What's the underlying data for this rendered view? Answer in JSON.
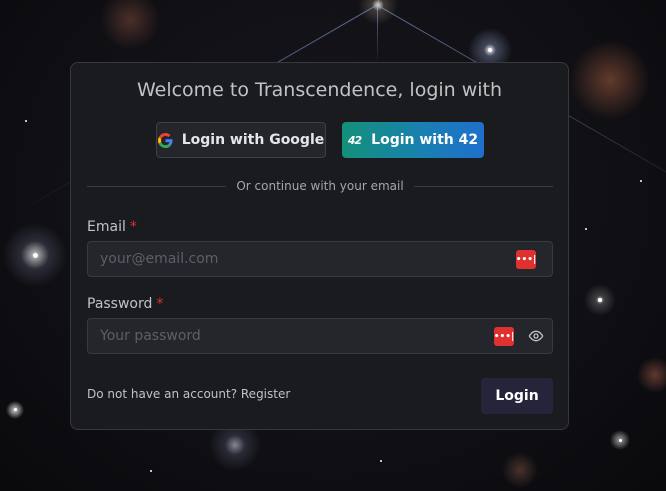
{
  "card": {
    "title": "Welcome to Transcendence, login with"
  },
  "oauth": {
    "google_label": "Login with Google",
    "ft_label": "Login with 42",
    "ft_icon": "42"
  },
  "divider": {
    "text": "Or continue with your email"
  },
  "form": {
    "email": {
      "label": "Email",
      "required_mark": "*",
      "placeholder": "your@email.com",
      "value": ""
    },
    "password": {
      "label": "Password",
      "required_mark": "*",
      "placeholder": "Your password",
      "value": ""
    },
    "password_manager_icon": "•••|"
  },
  "footer": {
    "register_text": "Do not have an account? Register",
    "login_label": "Login"
  },
  "colors": {
    "card_bg": "#1a1b1e",
    "required": "#e03131",
    "ft_gradient_start": "#14907a",
    "ft_gradient_end": "#1f6fcb",
    "login_button": "#25243a"
  }
}
